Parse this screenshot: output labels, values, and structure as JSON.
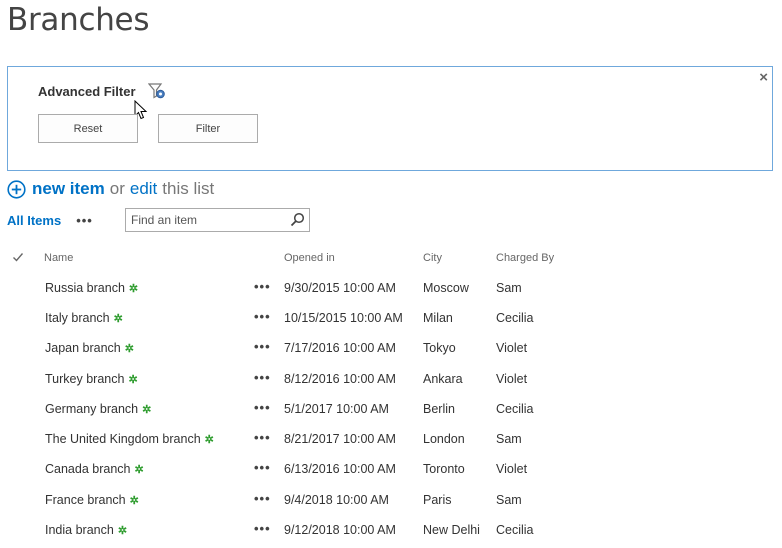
{
  "page": {
    "title": "Branches"
  },
  "filter_panel": {
    "title": "Advanced Filter",
    "close_glyph": "×",
    "reset_label": "Reset",
    "filter_label": "Filter",
    "icon": "filter-gear-icon"
  },
  "toolbar": {
    "new_item": "new item",
    "or": "or",
    "edit": "edit",
    "this_list": "this list"
  },
  "view": {
    "all_items": "All Items",
    "more": "•••",
    "search_placeholder": "Find an item"
  },
  "columns": {
    "name": "Name",
    "opened_in": "Opened in",
    "city": "City",
    "charged_by": "Charged By"
  },
  "rows": [
    {
      "name": "Russia branch",
      "opened_in": "9/30/2015 10:00 AM",
      "city": "Moscow",
      "charged_by": "Sam"
    },
    {
      "name": "Italy branch",
      "opened_in": "10/15/2015 10:00 AM",
      "city": "Milan",
      "charged_by": "Cecilia"
    },
    {
      "name": "Japan branch",
      "opened_in": "7/17/2016 10:00 AM",
      "city": "Tokyo",
      "charged_by": "Violet"
    },
    {
      "name": "Turkey branch",
      "opened_in": "8/12/2016 10:00 AM",
      "city": "Ankara",
      "charged_by": "Violet"
    },
    {
      "name": "Germany branch",
      "opened_in": "5/1/2017 10:00 AM",
      "city": "Berlin",
      "charged_by": "Cecilia"
    },
    {
      "name": "The United Kingdom branch",
      "opened_in": "8/21/2017 10:00 AM",
      "city": "London",
      "charged_by": "Sam"
    },
    {
      "name": "Canada branch",
      "opened_in": "6/13/2016 10:00 AM",
      "city": "Toronto",
      "charged_by": "Violet"
    },
    {
      "name": "France branch",
      "opened_in": "9/4/2018 10:00 AM",
      "city": "Paris",
      "charged_by": "Sam"
    },
    {
      "name": "India branch",
      "opened_in": "9/12/2018 10:00 AM",
      "city": "New Delhi",
      "charged_by": "Cecilia"
    }
  ],
  "row_badge": "✲",
  "row_more": "•••",
  "colors": {
    "accent": "#0072c6",
    "panel_border": "#6fa8dc",
    "new_badge": "#2e9c2e"
  }
}
